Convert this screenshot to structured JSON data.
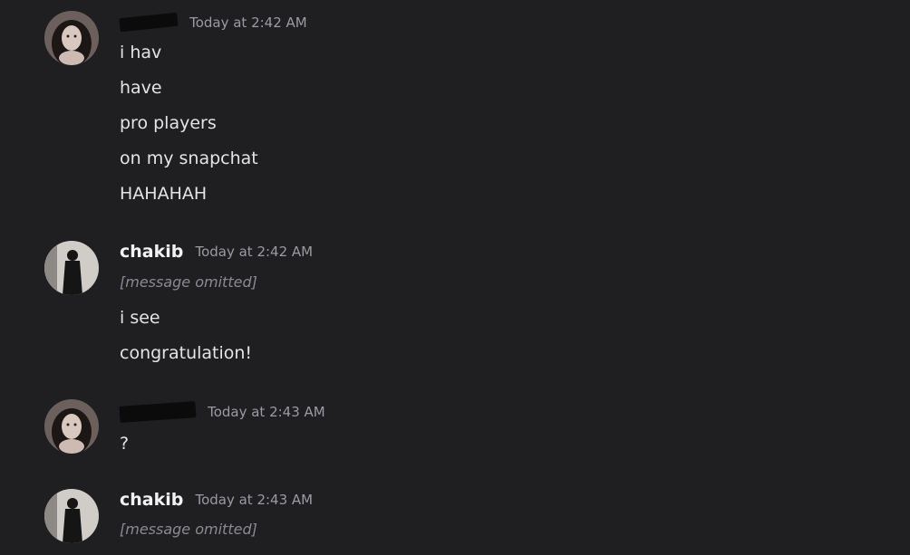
{
  "messages": [
    {
      "author": "",
      "author_redacted": true,
      "timestamp": "Today at 2:42 AM",
      "avatar_icon": "girl-portrait-avatar",
      "lines": [
        "i hav",
        "have",
        "pro players",
        "on my snapchat",
        "HAHAHAH"
      ]
    },
    {
      "author": "chakib",
      "author_redacted": false,
      "timestamp": "Today at 2:42 AM",
      "avatar_icon": "dark-figure-avatar",
      "lines": [
        "i see",
        "congratulation!"
      ]
    },
    {
      "author": "",
      "author_redacted": true,
      "timestamp": "Today at 2:43 AM",
      "avatar_icon": "girl-portrait-avatar",
      "lines": [
        "?"
      ]
    },
    {
      "author": "chakib",
      "author_redacted": false,
      "timestamp": "Today at 2:43 AM",
      "avatar_icon": "dark-figure-avatar",
      "lines": []
    }
  ],
  "omitted_note": "[message omitted]",
  "colors": {
    "background": "#1f1f22",
    "text": "#e4e4e6",
    "muted": "#9a9aa0"
  }
}
